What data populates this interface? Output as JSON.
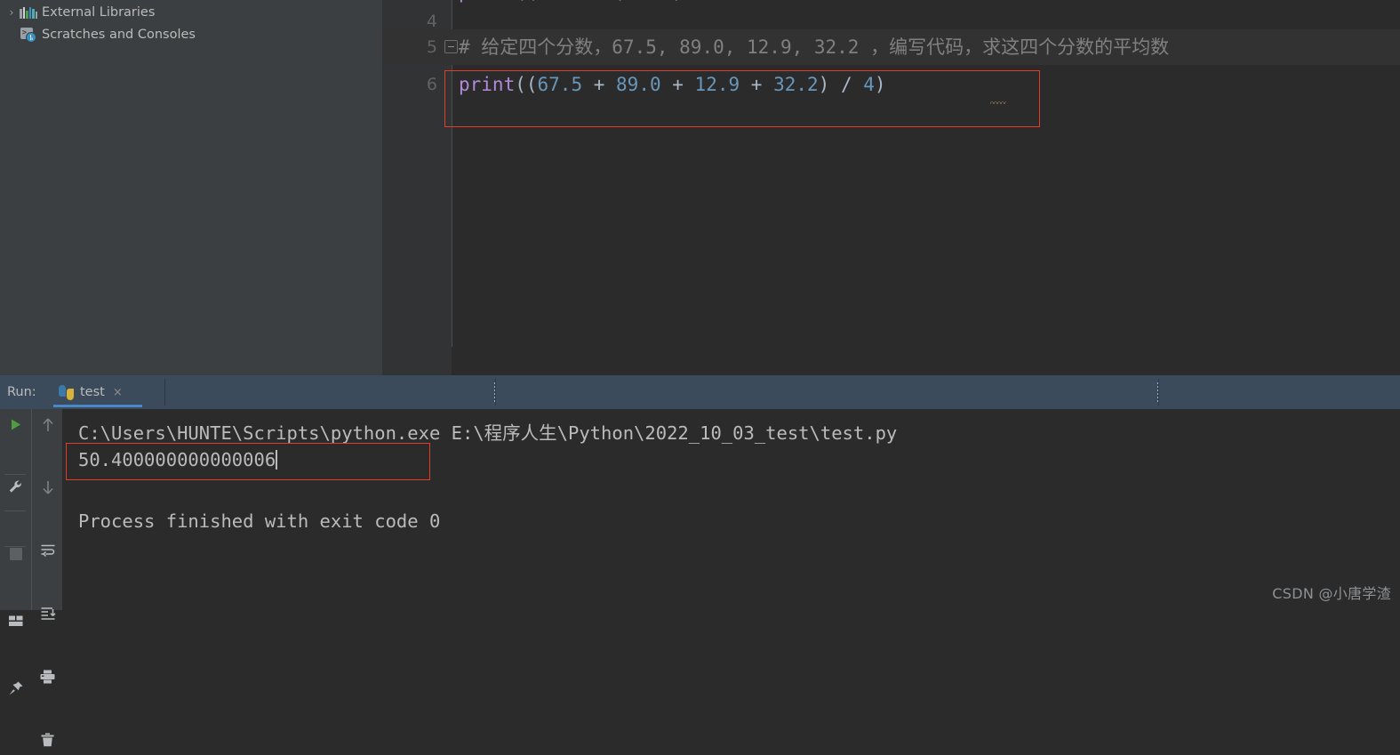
{
  "project_tree": {
    "items": [
      {
        "label": "External Libraries",
        "icon": "library-bars-icon",
        "expandable": true,
        "chevron": "›"
      },
      {
        "label": "Scratches and Consoles",
        "icon": "scratches-icon",
        "expandable": false,
        "chevron": "›"
      }
    ]
  },
  "editor": {
    "lines": [
      {
        "number": "4",
        "text": ""
      },
      {
        "number": "5",
        "text": "# 给定四个分数，67.5, 89.0, 12.9, 32.2 ，编写代码，求这四个分数的平均数",
        "type": "comment",
        "folded": true
      },
      {
        "number": "6",
        "text": "print((67.5 + 89.0 + 12.9 + 32.2) / 4)",
        "type": "code",
        "highlighted": true
      }
    ],
    "line5_comment": {
      "hash": "# ",
      "part1": "给定四个分数，",
      "nums": "67.5, 89.0, 12.9, 32.2 ",
      "part2": "，编写代码，求这四个分数的平均数"
    },
    "line6_tokens": {
      "fn": "print",
      "open": "((",
      "n1": "67.5",
      "op1": " + ",
      "n2": "89.0",
      "op2": " + ",
      "n3": "12.9",
      "op3": " + ",
      "n4": "32.2",
      "close1": ")",
      "div": " / ",
      "n5": "4",
      "close2": ")"
    },
    "colors": {
      "background": "#2b2b2b",
      "gutter": "#313335",
      "function": "#b389d9",
      "number": "#6897bb",
      "comment": "#808080",
      "punctuation": "#a9b7c6",
      "line_highlight": "#323232",
      "annotation_red": "#e23d28"
    }
  },
  "run_window": {
    "label": "Run:",
    "tab": {
      "name": "test",
      "icon": "python-icon",
      "close": "×"
    },
    "toolbar": {
      "left": [
        {
          "name": "rerun-button",
          "icon": "play-icon",
          "color": "#5a9e3f"
        },
        {
          "name": "edit-configurations-button",
          "icon": "wrench-icon"
        },
        {
          "name": "stop-button",
          "icon": "stop-square-icon"
        },
        {
          "name": "layout-button",
          "icon": "layout-icon"
        },
        {
          "name": "pin-tab-button",
          "icon": "pin-icon"
        }
      ],
      "right": [
        {
          "name": "up-the-stack-trace-button",
          "icon": "arrow-up-icon"
        },
        {
          "name": "down-the-stack-trace-button",
          "icon": "arrow-down-icon"
        },
        {
          "name": "soft-wrap-button",
          "icon": "soft-wrap-icon"
        },
        {
          "name": "scroll-to-end-button",
          "icon": "scroll-to-end-icon"
        },
        {
          "name": "print-button",
          "icon": "printer-icon"
        },
        {
          "name": "clear-all-button",
          "icon": "trash-icon"
        }
      ]
    },
    "console": {
      "command_line": "C:\\Users\\HUNTE\\Scripts\\python.exe E:\\程序人生\\Python\\2022_10_03_test\\test.py",
      "output_value": "50.400000000000006",
      "exit_line": "Process finished with exit code 0"
    }
  },
  "watermark": "CSDN @小唐学渣"
}
